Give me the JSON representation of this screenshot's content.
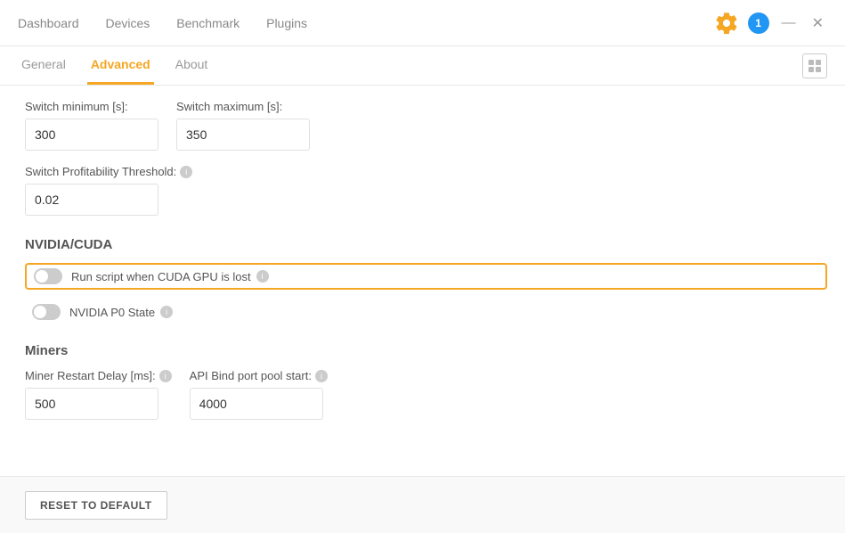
{
  "nav": {
    "items": [
      {
        "label": "Dashboard",
        "active": false
      },
      {
        "label": "Devices",
        "active": false
      },
      {
        "label": "Benchmark",
        "active": false
      },
      {
        "label": "Plugins",
        "active": false
      }
    ],
    "gear_icon": "⚙",
    "notification_count": "1",
    "minimize_label": "—",
    "close_label": "✕"
  },
  "tabs": {
    "items": [
      {
        "label": "General",
        "active": false
      },
      {
        "label": "Advanced",
        "active": true
      },
      {
        "label": "About",
        "active": false
      }
    ]
  },
  "form": {
    "switch_minimum_label": "Switch minimum [s]:",
    "switch_maximum_label": "Switch maximum [s]:",
    "switch_minimum_value": "300",
    "switch_maximum_value": "350",
    "switch_profitability_label": "Switch Profitability Threshold:",
    "switch_profitability_value": "0.02",
    "nvidia_section_title": "NVIDIA/CUDA",
    "run_script_label": "Run script when CUDA GPU is lost",
    "nvidia_p0_label": "NVIDIA P0 State",
    "miners_section_title": "Miners",
    "miner_restart_delay_label": "Miner Restart Delay [ms]:",
    "api_bind_port_label": "API Bind port pool start:",
    "miner_restart_delay_value": "500",
    "api_bind_port_value": "4000"
  },
  "bottom": {
    "reset_label": "RESET TO DEFAULT"
  },
  "icons": {
    "info": "i",
    "grid": "⊞"
  }
}
